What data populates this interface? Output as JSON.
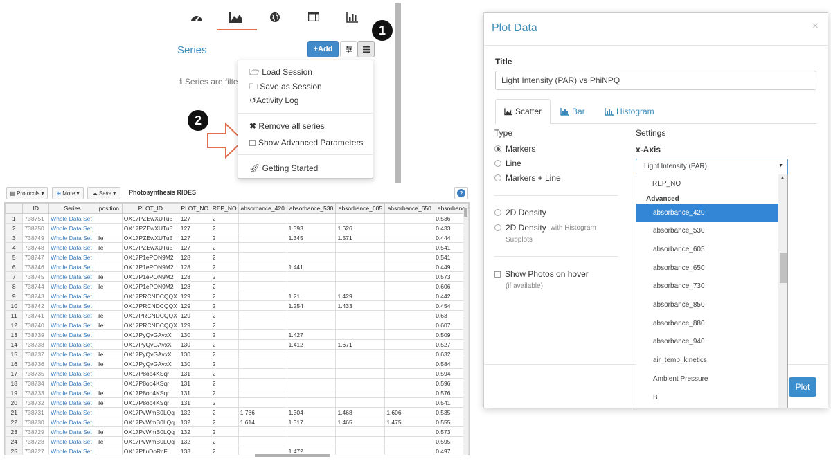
{
  "top_nav": {
    "icons": [
      "dashboard-icon",
      "area-chart-icon",
      "globe-icon",
      "table-icon",
      "bar-chart-icon"
    ],
    "active_index": 1
  },
  "series_panel": {
    "title": "Series",
    "add_label": "Add",
    "info_text": "Series are filte",
    "badge_1": "1",
    "badge_2": "2"
  },
  "menu": {
    "items": [
      {
        "label": "Load Session",
        "icon": "folder-open-icon"
      },
      {
        "label": "Save as Session",
        "icon": "folder-icon"
      },
      {
        "label": "Activity Log",
        "icon": "history-icon"
      },
      {
        "label": "Remove all series",
        "icon": "times-icon"
      },
      {
        "label": "Show Advanced Parameters",
        "icon": "checkbox-icon"
      },
      {
        "label": "Getting Started",
        "icon": "rocket-icon"
      }
    ]
  },
  "table_toolbar": {
    "protocols_label": "Protocols",
    "more_label": "More",
    "save_label": "Save",
    "title": "Photosynthesis RIDES",
    "help_label": "?"
  },
  "grid": {
    "columns": [
      "",
      "ID",
      "Series",
      "position",
      "PLOT_ID",
      "PLOT_NO",
      "REP_NO",
      "absorbance_420",
      "absorbance_530",
      "absorbance_605",
      "absorbance_650",
      "absorbanc"
    ],
    "rows": [
      [
        "1",
        "738751",
        "Whole Data Set",
        "",
        "OX17PZEwXUTu5",
        "127",
        "2",
        "",
        "",
        "",
        "",
        "0.536"
      ],
      [
        "2",
        "738750",
        "Whole Data Set",
        "",
        "OX17PZEwXUTu5",
        "127",
        "2",
        "",
        "1.393",
        "1.626",
        "",
        "0.433"
      ],
      [
        "3",
        "738749",
        "Whole Data Set",
        "ile",
        "OX17PZEwXUTu5",
        "127",
        "2",
        "",
        "1.345",
        "1.571",
        "",
        "0.444"
      ],
      [
        "4",
        "738748",
        "Whole Data Set",
        "ile",
        "OX17PZEwXUTu5",
        "127",
        "2",
        "",
        "",
        "",
        "",
        "0.541"
      ],
      [
        "5",
        "738747",
        "Whole Data Set",
        "",
        "OX17P1ePON9M2",
        "128",
        "2",
        "",
        "",
        "",
        "",
        "0.541"
      ],
      [
        "6",
        "738746",
        "Whole Data Set",
        "",
        "OX17P1ePON9M2",
        "128",
        "2",
        "",
        "1.441",
        "",
        "",
        "0.449"
      ],
      [
        "7",
        "738745",
        "Whole Data Set",
        "ile",
        "OX17P1ePON9M2",
        "128",
        "2",
        "",
        "",
        "",
        "",
        "0.573"
      ],
      [
        "8",
        "738744",
        "Whole Data Set",
        "ile",
        "OX17P1ePON9M2",
        "128",
        "2",
        "",
        "",
        "",
        "",
        "0.606"
      ],
      [
        "9",
        "738743",
        "Whole Data Set",
        "",
        "OX17PRCNDCQQX",
        "129",
        "2",
        "",
        "1.21",
        "1.429",
        "",
        "0.442"
      ],
      [
        "10",
        "738742",
        "Whole Data Set",
        "",
        "OX17PRCNDCQQX",
        "129",
        "2",
        "",
        "1.254",
        "1.433",
        "",
        "0.454"
      ],
      [
        "11",
        "738741",
        "Whole Data Set",
        "ile",
        "OX17PRCNDCQQX",
        "129",
        "2",
        "",
        "",
        "",
        "",
        "0.63"
      ],
      [
        "12",
        "738740",
        "Whole Data Set",
        "ile",
        "OX17PRCNDCQQX",
        "129",
        "2",
        "",
        "",
        "",
        "",
        "0.607"
      ],
      [
        "13",
        "738739",
        "Whole Data Set",
        "",
        "OX17PyQvGAvxX",
        "130",
        "2",
        "",
        "1.427",
        "",
        "",
        "0.509"
      ],
      [
        "14",
        "738738",
        "Whole Data Set",
        "",
        "OX17PyQvGAvxX",
        "130",
        "2",
        "",
        "1.412",
        "1.671",
        "",
        "0.527"
      ],
      [
        "15",
        "738737",
        "Whole Data Set",
        "ile",
        "OX17PyQvGAvxX",
        "130",
        "2",
        "",
        "",
        "",
        "",
        "0.632"
      ],
      [
        "16",
        "738736",
        "Whole Data Set",
        "ile",
        "OX17PyQvGAvxX",
        "130",
        "2",
        "",
        "",
        "",
        "",
        "0.584"
      ],
      [
        "17",
        "738735",
        "Whole Data Set",
        "",
        "OX17P8oo4KSqr",
        "131",
        "2",
        "",
        "",
        "",
        "",
        "0.594"
      ],
      [
        "18",
        "738734",
        "Whole Data Set",
        "",
        "OX17P8oo4KSqr",
        "131",
        "2",
        "",
        "",
        "",
        "",
        "0.596"
      ],
      [
        "19",
        "738733",
        "Whole Data Set",
        "ile",
        "OX17P8oo4KSqr",
        "131",
        "2",
        "",
        "",
        "",
        "",
        "0.576"
      ],
      [
        "20",
        "738732",
        "Whole Data Set",
        "ile",
        "OX17P8oo4KSqr",
        "131",
        "2",
        "",
        "",
        "",
        "",
        "0.541"
      ],
      [
        "21",
        "738731",
        "Whole Data Set",
        "",
        "OX17PvWmB0LQq",
        "132",
        "2",
        "1.786",
        "1.304",
        "1.468",
        "1.606",
        "0.535"
      ],
      [
        "22",
        "738730",
        "Whole Data Set",
        "",
        "OX17PvWmB0LQq",
        "132",
        "2",
        "1.614",
        "1.317",
        "1.465",
        "1.475",
        "0.555"
      ],
      [
        "23",
        "738729",
        "Whole Data Set",
        "ile",
        "OX17PvWmB0LQq",
        "132",
        "2",
        "",
        "",
        "",
        "",
        "0.573"
      ],
      [
        "24",
        "738728",
        "Whole Data Set",
        "ile",
        "OX17PvWmB0LQq",
        "132",
        "2",
        "",
        "",
        "",
        "",
        "0.595"
      ],
      [
        "25",
        "738727",
        "Whole Data Set",
        "",
        "OX17PfluDoRcF",
        "133",
        "2",
        "",
        "1.472",
        "",
        "",
        "0.497"
      ]
    ]
  },
  "modal": {
    "title": "Plot Data",
    "close": "×",
    "title_label": "Title",
    "title_value": "Light Intensity (PAR) vs PhiNPQ",
    "tabs": [
      {
        "label": "Scatter",
        "active": true
      },
      {
        "label": "Bar",
        "active": false
      },
      {
        "label": "Histogram",
        "active": false
      }
    ],
    "type_label": "Type",
    "settings_label": "Settings",
    "xaxis_label": "x-Axis",
    "type_options": [
      "Markers",
      "Line",
      "Markers + Line"
    ],
    "density": "2D Density",
    "density_hist": "2D Density",
    "density_hist_suffix": "with Histogram",
    "density_hist_sub": "Subplots",
    "photos": "Show Photos on hover",
    "photos_sub": "(if available)",
    "select_value": "Light Intensity (PAR)",
    "list_top": "REP_NO",
    "list_group": "Advanced",
    "list_items": [
      "absorbance_420",
      "absorbance_530",
      "absorbance_605",
      "absorbance_650",
      "absorbance_730",
      "absorbance_850",
      "absorbance_880",
      "absorbance_940",
      "air_temp_kinetics",
      "Ambient Pressure",
      "B"
    ],
    "plot_button": "Plot"
  },
  "colors": {
    "link_blue": "#3c8dbc",
    "primary_button": "#428bca",
    "highlight": "#3385d6",
    "arrow_outline": "#e07050"
  }
}
